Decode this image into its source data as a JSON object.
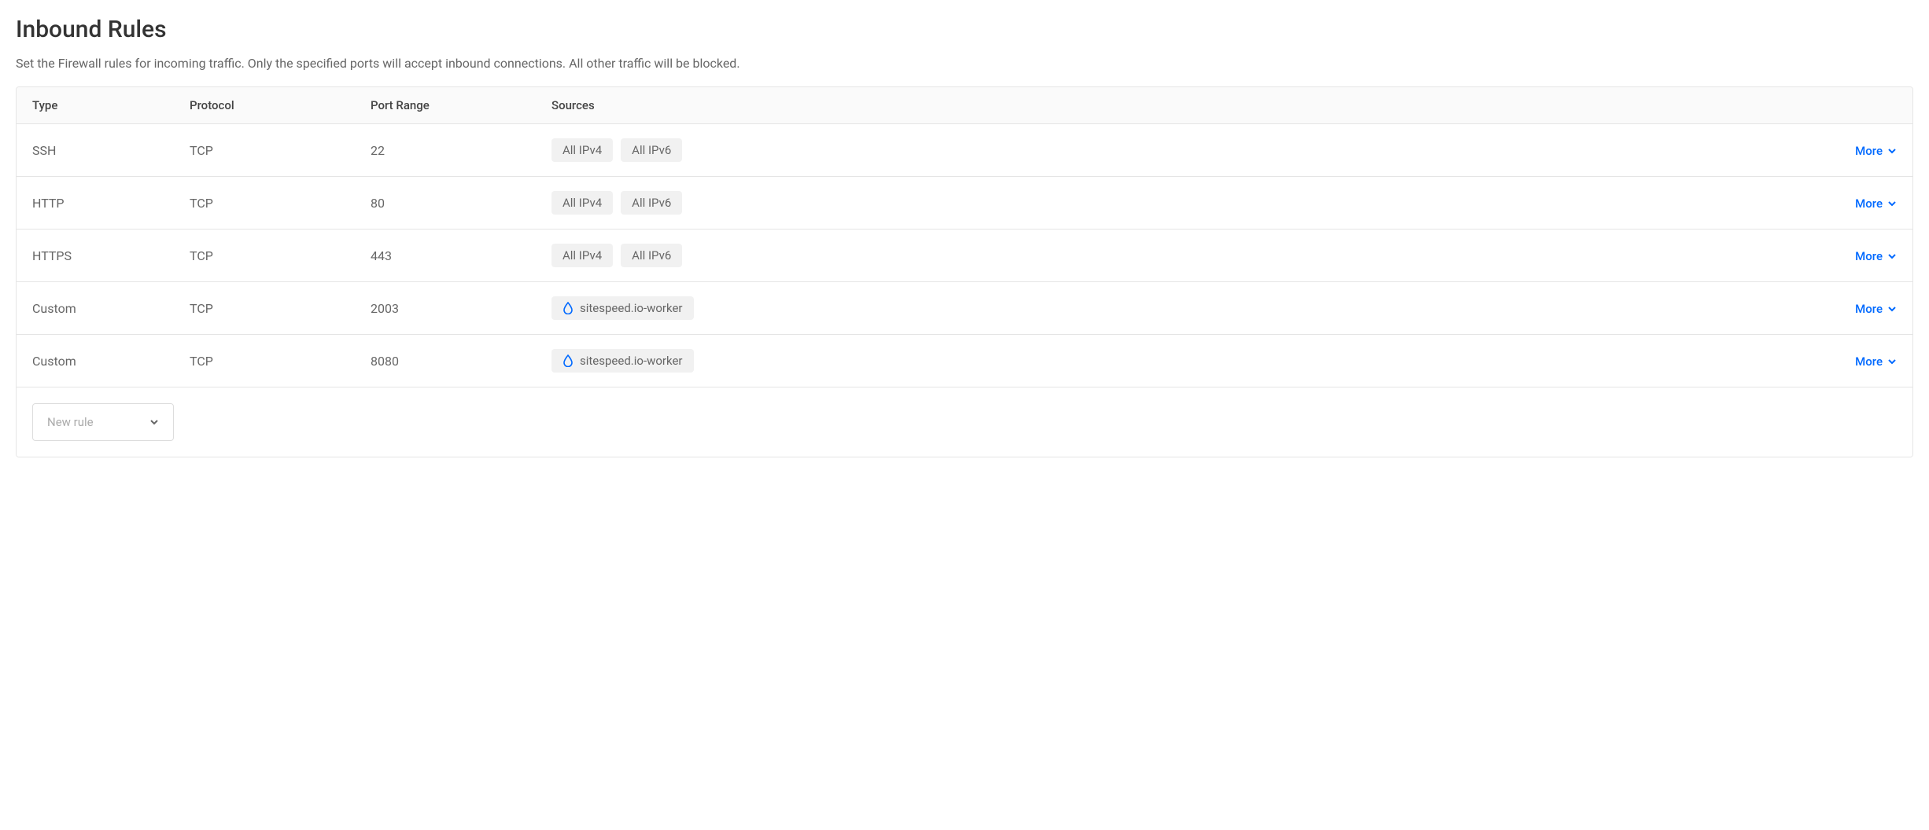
{
  "title": "Inbound Rules",
  "subtitle": "Set the Firewall rules for incoming traffic. Only the specified ports will accept inbound connections. All other traffic will be blocked.",
  "columns": {
    "type": "Type",
    "protocol": "Protocol",
    "port_range": "Port Range",
    "sources": "Sources"
  },
  "more_label": "More",
  "new_rule_label": "New rule",
  "rules": [
    {
      "type": "SSH",
      "protocol": "TCP",
      "port_range": "22",
      "sources": [
        {
          "label": "All IPv4",
          "icon": null
        },
        {
          "label": "All IPv6",
          "icon": null
        }
      ]
    },
    {
      "type": "HTTP",
      "protocol": "TCP",
      "port_range": "80",
      "sources": [
        {
          "label": "All IPv4",
          "icon": null
        },
        {
          "label": "All IPv6",
          "icon": null
        }
      ]
    },
    {
      "type": "HTTPS",
      "protocol": "TCP",
      "port_range": "443",
      "sources": [
        {
          "label": "All IPv4",
          "icon": null
        },
        {
          "label": "All IPv6",
          "icon": null
        }
      ]
    },
    {
      "type": "Custom",
      "protocol": "TCP",
      "port_range": "2003",
      "sources": [
        {
          "label": "sitespeed.io-worker",
          "icon": "droplet"
        }
      ]
    },
    {
      "type": "Custom",
      "protocol": "TCP",
      "port_range": "8080",
      "sources": [
        {
          "label": "sitespeed.io-worker",
          "icon": "droplet"
        }
      ]
    }
  ]
}
